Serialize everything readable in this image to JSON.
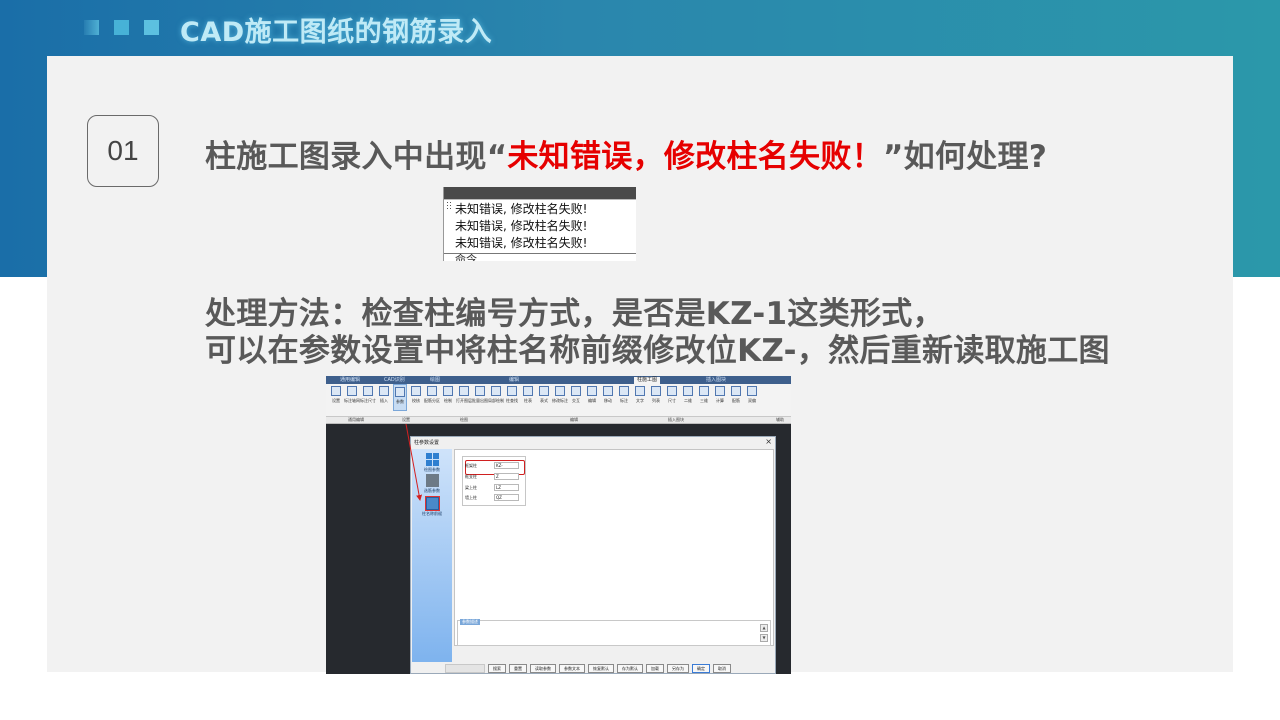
{
  "header": {
    "title": "CAD施工图纸的钢筋录入"
  },
  "question": {
    "number": "01",
    "prefix": "柱施工图录入中出现“",
    "highlight": "未知错误，修改柱名失败！",
    "suffix": "”如何处理?",
    "highlight_color": "#e60000"
  },
  "error_log": {
    "lines": [
      "未知错误, 修改柱名失败!",
      "未知错误, 修改柱名失败!",
      "未知错误, 修改柱名失败!"
    ],
    "clipped_line": "命令"
  },
  "solution": {
    "line1": "处理方法：检查柱编号方式，是否是KZ-1这类形式，",
    "line2": "可以在参数设置中将柱名称前缀修改位KZ-，然后重新读取施工图"
  },
  "cad_window": {
    "tabs": [
      "通用编辑",
      "CAD识别",
      "绘图",
      "编辑",
      "柱施工图",
      "插入图块"
    ],
    "active_tab": "柱施工图",
    "ribbon_tools": [
      "设置",
      "标注轴网",
      "标注尺寸",
      "插入",
      "参数",
      "校核",
      "配筋分区",
      "绘制",
      "打开图层",
      "批量出图",
      "局部绘制",
      "柱查找",
      "柱表",
      "表式",
      "修改标注",
      "交互",
      "编辑",
      "移动",
      "标注",
      "文字",
      "列表",
      "尺寸",
      "二维",
      "三维",
      "计算",
      "配筋",
      "双偏"
    ],
    "ribbon_groups": [
      "通用编辑",
      "设置",
      "绘图",
      "编辑",
      "插入图块",
      "辅助"
    ],
    "dialog": {
      "title": "柱参数设置",
      "close": "×",
      "sidebar": [
        "绘图参数",
        "选筋参数",
        "柱名称前缀"
      ],
      "selected_sidebar": "柱名称前缀",
      "params": [
        {
          "label": "框架柱",
          "value": "KZ-"
        },
        {
          "label": "框支柱",
          "value": "Z"
        },
        {
          "label": "梁上柱",
          "value": "LZ"
        },
        {
          "label": "墙上柱",
          "value": "QZ"
        }
      ],
      "note_label": "参数描述",
      "scroll_up": "▲",
      "scroll_down": "▼",
      "footer_buttons": [
        "搜索",
        "重置",
        "读取参数",
        "参数文本",
        "恢复默认",
        "存为默认",
        "加载",
        "另存为",
        "确定",
        "取消"
      ],
      "primary_button": "确定"
    }
  }
}
